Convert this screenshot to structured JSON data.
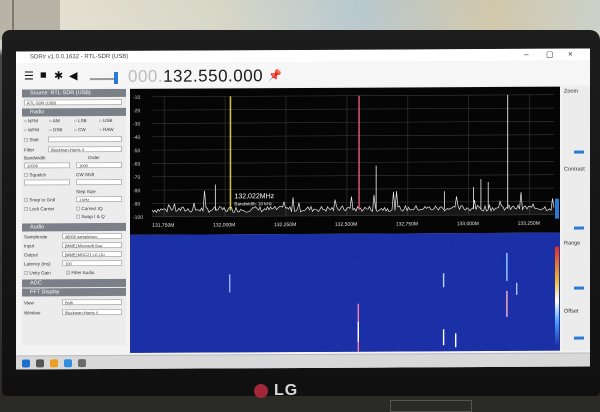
{
  "window": {
    "title": "SDR# v1.0.0.1632 - RTL-SDR (USB)",
    "minimize": "–",
    "maximize": "▢",
    "close": "×"
  },
  "toolbar": {
    "menu_icon": "hamburger-icon",
    "play_icon": "play-icon",
    "settings_icon": "gear-icon",
    "volume_icon": "speaker-icon",
    "frequency_dim": "000.",
    "frequency": "132.550.000",
    "pin_icon": "pin-icon"
  },
  "panel": {
    "source_header": "Source: RTL-SDR (USB)",
    "source_value": "RTL-SDR (USB)",
    "radio_header": "Radio",
    "modes_row1": [
      "NFM",
      "AM",
      "LSB",
      "USB"
    ],
    "modes_row2": [
      "WFM",
      "DSB",
      "CW",
      "RAW"
    ],
    "shift_label": "Shift",
    "filter_label": "Filter",
    "filter_value": "Blackman-Harris 4",
    "bandwidth_label": "Bandwidth",
    "order_label": "Order",
    "bandwidth_value": "10000",
    "order_value": "1000",
    "squelch_label": "Squelch",
    "cw_shift_label": "CW Shift",
    "step_size_label": "Step Size",
    "snap_label": "Snap to Grid",
    "step_value": "1 kHz",
    "lock_carrier_label": "Lock Carrier",
    "correct_iq_label": "Correct IQ",
    "swap_iq_label": "Swap I & Q",
    "audio_header": "Audio",
    "samplerate_label": "Samplerate",
    "samplerate_value": "48000 sample/sec",
    "input_label": "Input",
    "input_value": "[MME] Microsoft Sou",
    "output_label": "Output",
    "output_value": "[MME] MOC21 LG (Ju",
    "latency_label": "Latency (ms)",
    "latency_value": "100",
    "unity_gain_label": "Unity Gain",
    "filter_audio_label": "Filter Audio",
    "agc_header": "AGC",
    "fft_header": "FFT Display",
    "view_label": "View",
    "view_value": "Both",
    "window_label": "Window",
    "window_value": "Blackman-Harris 4"
  },
  "spectrum": {
    "y_ticks": [
      "-10",
      "-20",
      "-30",
      "-40",
      "-50",
      "-60",
      "-70",
      "-80",
      "-90",
      "-100"
    ],
    "x_ticks": [
      "131,750M",
      "132,000M",
      "132,250M",
      "132,500M",
      "132,750M",
      "133,000M",
      "133,250M"
    ],
    "cursor_label": "132,022MHz",
    "cursor_sub": "Bandwidth: 10 kHz",
    "signals": [
      {
        "freq_mhz": 132.022,
        "level_db": -10,
        "color": "#e8d24a"
      },
      {
        "freq_mhz": 132.55,
        "level_db": -10,
        "color": "#e05a7a"
      },
      {
        "freq_mhz": 133.16,
        "level_db": -10,
        "color": "#ffffff"
      }
    ]
  },
  "right_panel": {
    "zoom": "Zoom",
    "contrast": "Contrast",
    "range": "Range",
    "offset": "Offset"
  },
  "colors": {
    "waterfall_bg": "#1b2fa6",
    "accent": "#2a7bd6",
    "section_header": "#7b8088"
  },
  "monitor": {
    "brand": "LG"
  }
}
